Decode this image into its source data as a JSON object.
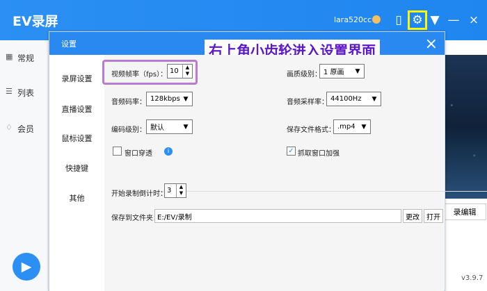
{
  "app": {
    "title": "EV录屏",
    "user": "lara520cc",
    "version": "v3.9.7"
  },
  "sidebar": {
    "items": [
      {
        "label": "常规",
        "icon": "grid-icon"
      },
      {
        "label": "列表",
        "icon": "list-icon"
      },
      {
        "label": "会员",
        "icon": "diamond-icon"
      }
    ]
  },
  "background": {
    "edit_label": "录编辑"
  },
  "dialog": {
    "title": "设置",
    "banner": "右上角小齿轮进入设置界面",
    "tabs": [
      "录屏设置",
      "直播设置",
      "鼠标设置",
      "快捷键",
      "其他"
    ],
    "fields": {
      "fps_label": "视频帧率（fps）：",
      "fps_value": "10",
      "quality_label": "画质级别：",
      "quality_value": "1 原画",
      "audio_bitrate_label": "音频码率：",
      "audio_bitrate_value": "128kbps",
      "sample_rate_label": "音频采样率：",
      "sample_rate_value": "44100Hz",
      "encode_label": "编码级别：",
      "encode_value": "默认",
      "format_label": "保存文件格式：",
      "format_value": ".mp4",
      "window_through_label": "窗口穿透",
      "capture_boost_label": "抓取窗口加强",
      "countdown_label": "开始录制倒计时：",
      "countdown_value": "3",
      "save_folder_label": "保存到文件夹：",
      "save_folder_value": "E:/EV/录制",
      "change_label": "更改",
      "open_label": "打开"
    }
  },
  "colors": {
    "brand": "#2b8ff3",
    "highlight": "#fff600",
    "annotation": "#b77bd1"
  }
}
